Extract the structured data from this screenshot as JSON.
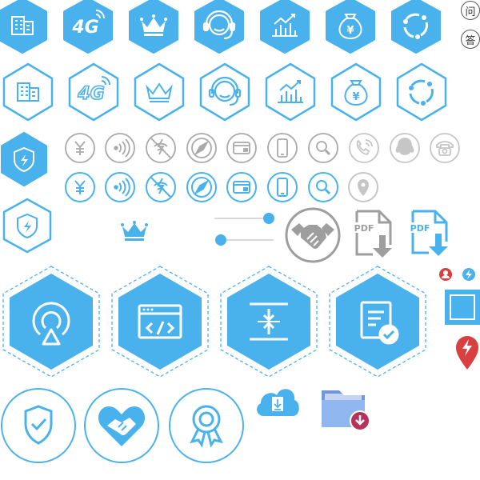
{
  "palette": {
    "brand_blue": "#49b2ec",
    "brand_blue_light": "#7ccbf3",
    "gray": "#a9a9a9",
    "gray_light": "#c6c6c6",
    "red": "#d84040",
    "folder_blue": "#7fa9e6",
    "folder_badge": "#b5335a",
    "text_dark": "#333333"
  },
  "row1_filled_hexagons": [
    {
      "name": "building-icon"
    },
    {
      "name": "4g-icon"
    },
    {
      "name": "crown-icon"
    },
    {
      "name": "headset-icon"
    },
    {
      "name": "bar-chart-icon"
    },
    {
      "name": "money-bag-icon"
    },
    {
      "name": "refresh-cycle-icon"
    }
  ],
  "row2_outline_hexagons": [
    {
      "name": "building-icon"
    },
    {
      "name": "4g-icon"
    },
    {
      "name": "crown-icon"
    },
    {
      "name": "headset-icon"
    },
    {
      "name": "bar-chart-icon"
    },
    {
      "name": "money-bag-icon"
    },
    {
      "name": "refresh-cycle-icon"
    }
  ],
  "small_circle_badges": {
    "question": "问",
    "answer": "答"
  },
  "icon_text": {
    "four_g": "4G",
    "yen": "¥",
    "pdf": "PDF"
  },
  "gray_circle_row": [
    {
      "name": "yen-icon"
    },
    {
      "name": "nfc-signal-icon"
    },
    {
      "name": "no-signal-icon"
    },
    {
      "name": "compass-icon"
    },
    {
      "name": "card-icon"
    },
    {
      "name": "phone-icon"
    },
    {
      "name": "search-icon"
    },
    {
      "name": "phone-call-icon"
    },
    {
      "name": "qq-icon"
    },
    {
      "name": "telephone-icon"
    }
  ],
  "blue_circle_row": [
    {
      "name": "yen-icon"
    },
    {
      "name": "nfc-signal-icon"
    },
    {
      "name": "no-signal-icon"
    },
    {
      "name": "compass-icon"
    },
    {
      "name": "card-icon"
    },
    {
      "name": "phone-icon"
    },
    {
      "name": "search-icon"
    },
    {
      "name": "location-pin-icon"
    }
  ],
  "sliders": [
    {
      "name": "slider-right",
      "value": 1.0
    },
    {
      "name": "slider-left",
      "value": 0.0
    }
  ],
  "large_dashed_hexagons": [
    {
      "name": "broadcast-icon"
    },
    {
      "name": "code-window-icon"
    },
    {
      "name": "vertical-compress-icon"
    },
    {
      "name": "document-check-icon"
    }
  ],
  "bottom_circles": [
    {
      "name": "shield-check-icon"
    },
    {
      "name": "heart-handshake-icon"
    },
    {
      "name": "award-ribbon-icon"
    }
  ]
}
